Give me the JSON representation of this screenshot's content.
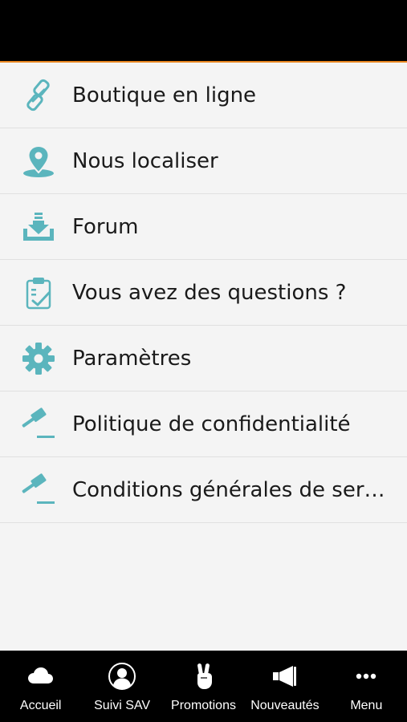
{
  "colors": {
    "accent_icon": "#5bb5bd",
    "top_bar": "#000000",
    "top_bar_border": "#e8851f",
    "background": "#f4f4f4",
    "tab_bar": "#000000",
    "tab_text": "#ffffff",
    "item_text": "#1a1a1a"
  },
  "menu": {
    "items": [
      {
        "label": "Boutique en ligne",
        "icon": "link-icon"
      },
      {
        "label": "Nous localiser",
        "icon": "map-pin-icon"
      },
      {
        "label": "Forum",
        "icon": "download-tray-icon"
      },
      {
        "label": "Vous avez des questions ?",
        "icon": "clipboard-check-icon"
      },
      {
        "label": "Paramètres",
        "icon": "gear-icon"
      },
      {
        "label": "Politique de confidentialité",
        "icon": "gavel-icon"
      },
      {
        "label": "Conditions générales de service",
        "icon": "gavel-icon"
      }
    ]
  },
  "tabbar": {
    "tabs": [
      {
        "label": "Accueil",
        "icon": "cloud-icon"
      },
      {
        "label": "Suivi SAV",
        "icon": "user-circle-icon"
      },
      {
        "label": "Promotions",
        "icon": "peace-hand-icon"
      },
      {
        "label": "Nouveautés",
        "icon": "megaphone-icon"
      },
      {
        "label": "Menu",
        "icon": "more-dots-icon"
      }
    ]
  }
}
